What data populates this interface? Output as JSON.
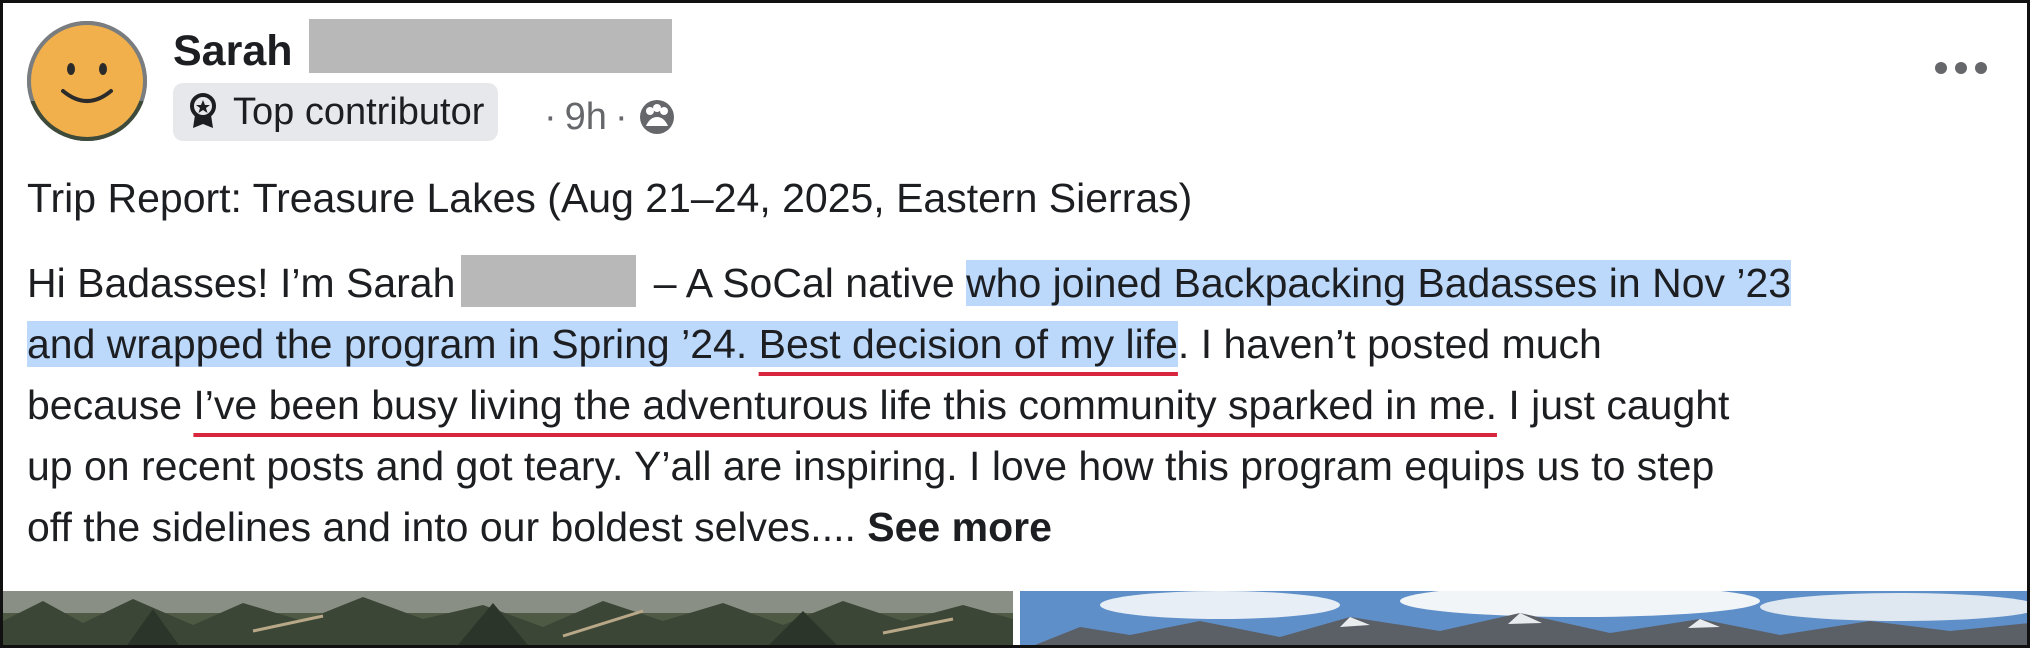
{
  "author": {
    "name": "Sarah"
  },
  "badge": {
    "label": "Top contributor",
    "icon": "top-contributor-badge-icon"
  },
  "meta": {
    "separator": "·",
    "time": "9h",
    "audience_icon": "group-audience-icon"
  },
  "post": {
    "title": "Trip Report: Treasure Lakes (Aug 21–24, 2025, Eastern Sierras)",
    "lines": [
      {
        "a": "Hi Badasses! I’m Sarah",
        "b": " – A SoCal native ",
        "c": "who joined Backpacking Badasses in Nov ’23"
      },
      {
        "a": "and wrapped the program in Spring ’24. ",
        "b": "Best decision of my life",
        "c": ". I haven’t posted much"
      },
      {
        "a": "because ",
        "b": "I’ve been busy living the adventurous life this community sparked in me.",
        "c": " I just caught"
      },
      {
        "a": "up on recent posts and got teary. Y’all are inspiring. I love how this program equips us to step"
      },
      {
        "a": "off the sidelines and into our boldest selves.... ",
        "see_more": "See more"
      }
    ]
  },
  "colors": {
    "highlight": "#bcd9fb",
    "underline": "#d7263d",
    "redaction": "#b8b8b8",
    "meta_text": "#65676b"
  }
}
